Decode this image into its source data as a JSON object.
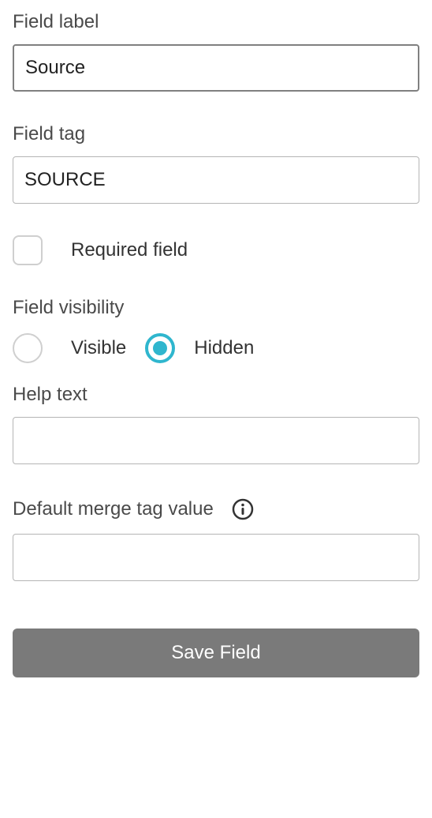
{
  "field_label": {
    "label": "Field label",
    "value": "Source"
  },
  "field_tag": {
    "label": "Field tag",
    "value": "SOURCE"
  },
  "required": {
    "label": "Required field",
    "checked": false
  },
  "visibility": {
    "label": "Field visibility",
    "options": {
      "visible": "Visible",
      "hidden": "Hidden"
    },
    "selected": "hidden"
  },
  "help_text": {
    "label": "Help text",
    "value": ""
  },
  "default_merge": {
    "label": "Default merge tag value",
    "value": ""
  },
  "actions": {
    "save": "Save Field"
  }
}
